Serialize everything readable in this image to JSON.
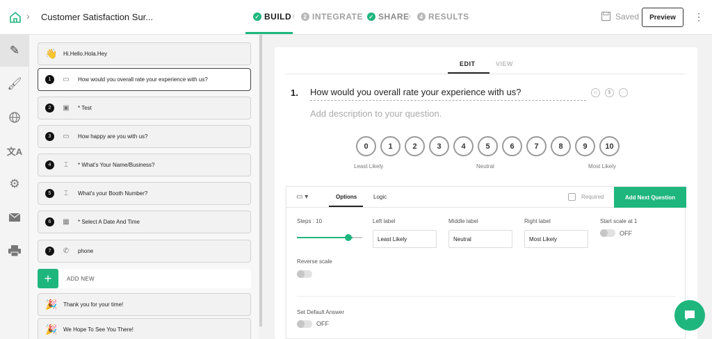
{
  "header": {
    "survey_title": "Customer Satisfaction Sur...",
    "steps": [
      {
        "num": "✓",
        "label": "BUILD"
      },
      {
        "num": "2",
        "label": "INTEGRATE"
      },
      {
        "num": "✓",
        "label": "SHARE"
      },
      {
        "num": "4",
        "label": "RESULTS"
      }
    ],
    "saved_label": "Saved",
    "preview_label": "Preview",
    "colors": {
      "accent": "#1fb67e"
    }
  },
  "rail": {
    "icons": [
      "pencil-icon",
      "paint-brush-icon",
      "globe-icon",
      "translate-icon",
      "gear-icon",
      "envelope-icon",
      "printer-icon"
    ]
  },
  "questions": {
    "welcome": "Hi.Hello.Hola.Hey",
    "items": [
      {
        "num": "1",
        "icon": "monitor-icon",
        "text": "How would you overall rate your experience with us?"
      },
      {
        "num": "2",
        "icon": "contact-card-icon",
        "text": "* Test"
      },
      {
        "num": "3",
        "icon": "monitor-icon",
        "text": "How happy are you with us?"
      },
      {
        "num": "4",
        "icon": "text-input-icon",
        "text": "* What's Your Name/Business?"
      },
      {
        "num": "5",
        "icon": "text-input-icon",
        "text": "What's your Booth Number?"
      },
      {
        "num": "6",
        "icon": "calendar-icon",
        "text": "* Select A Date And Time"
      },
      {
        "num": "7",
        "icon": "phone-icon",
        "text": "phone"
      }
    ],
    "add_new_label": "ADD NEW",
    "endings": [
      "Thank you for your time!",
      "We Hope To See You There!"
    ]
  },
  "editor": {
    "tabs": {
      "edit": "EDIT",
      "view": "VIEW"
    },
    "question_number": "1.",
    "question_title": "How would you overall rate your experience with us?",
    "description_placeholder": "Add description to your question.",
    "scale": [
      "0",
      "1",
      "2",
      "3",
      "4",
      "5",
      "6",
      "7",
      "8",
      "9",
      "10"
    ],
    "scale_labels": {
      "left": "Least Likely",
      "middle": "Neutral",
      "right": "Most Likely"
    }
  },
  "options": {
    "tabs": {
      "options": "Options",
      "logic": "Logic"
    },
    "required_label": "Required",
    "add_next_label": "Add Next Question",
    "steps_label": "Steps : 10",
    "steps_value": 10,
    "left_label_title": "Left label",
    "left_label_value": "Least Likely",
    "middle_label_title": "Middle label",
    "middle_label_value": "Neutral",
    "right_label_title": "Right label",
    "right_label_value": "Most Likely",
    "start_scale_title": "Start scale at 1",
    "start_scale_state": "OFF",
    "reverse_scale_title": "Reverse scale",
    "default_answer_title": "Set Default Answer",
    "default_answer_state": "OFF"
  }
}
